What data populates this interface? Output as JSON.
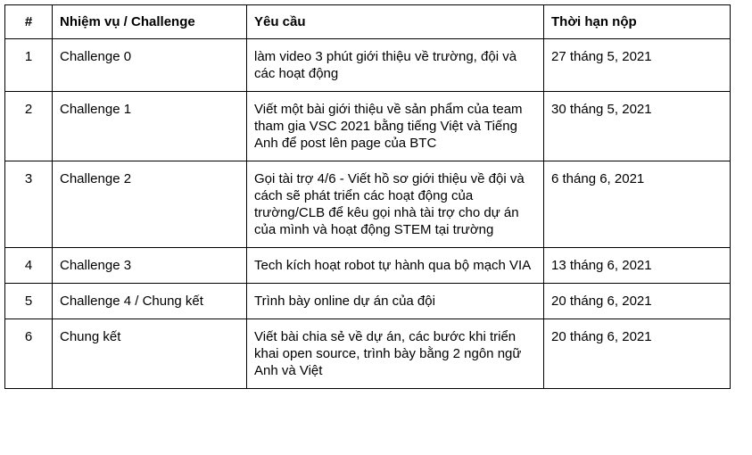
{
  "table": {
    "headers": [
      "#",
      "Nhiệm vụ / Challenge",
      "Yêu cầu",
      "Thời hạn nộp"
    ],
    "rows": [
      {
        "num": "1",
        "task": "Challenge 0",
        "requirement": "làm video 3 phút giới thiệu về trường, đội và các hoạt động",
        "deadline": "27 tháng 5, 2021"
      },
      {
        "num": "2",
        "task": "Challenge 1",
        "requirement": "Viết một bài giới thiệu về sản phẩm của team tham gia VSC 2021 bằng tiếng Việt và Tiếng Anh để post lên page của BTC",
        "deadline": "30 tháng 5, 2021"
      },
      {
        "num": "3",
        "task": "Challenge 2",
        "requirement": "Gọi tài trợ 4/6 - Viết hồ sơ giới thiệu về đội và cách sẽ phát triển các hoạt động của trường/CLB để kêu gọi nhà tài trợ cho dự án của mình và hoạt động STEM tại trường",
        "deadline": "6 tháng 6, 2021"
      },
      {
        "num": "4",
        "task": "Challenge 3",
        "requirement": "Tech kích hoạt robot tự hành qua bộ mạch VIA",
        "deadline": "13 tháng 6, 2021"
      },
      {
        "num": "5",
        "task": "Challenge 4 / Chung kết",
        "requirement": "Trình bày online dự án của đội",
        "deadline": "20 tháng 6, 2021"
      },
      {
        "num": "6",
        "task": "Chung kết",
        "requirement": "Viết bài chia sẻ về dự án, các bước khi triển khai open source, trình bày bằng 2 ngôn ngữ Anh và Việt",
        "deadline": "20 tháng 6, 2021"
      }
    ]
  }
}
